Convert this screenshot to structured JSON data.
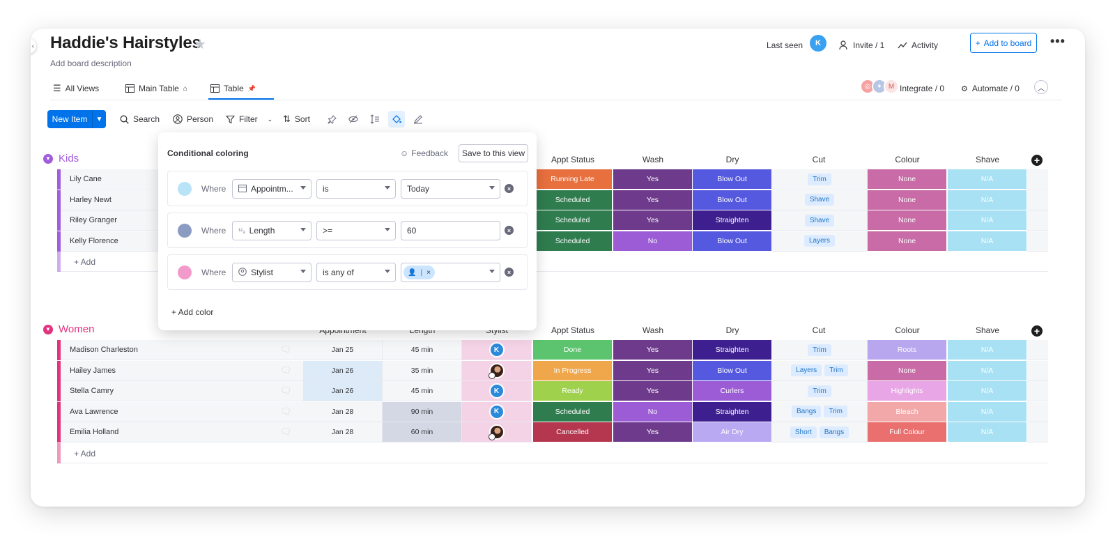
{
  "board": {
    "title": "Haddie's Hairstyles",
    "description": "Add board description"
  },
  "header": {
    "last_seen_label": "Last seen",
    "last_seen_avatar": "K",
    "invite_label": "Invite / 1",
    "activity_label": "Activity",
    "add_to_board_label": "Add to board"
  },
  "tabs": {
    "all_views": "All Views",
    "main_table": "Main Table",
    "table": "Table"
  },
  "integrations": {
    "integrate_label": "Integrate / 0",
    "automate_label": "Automate / 0"
  },
  "toolbar": {
    "new_item": "New Item",
    "search": "Search",
    "person": "Person",
    "filter": "Filter",
    "sort": "Sort"
  },
  "columns": {
    "appointment": "Appointment",
    "length": "Length",
    "stylist": "Stylist",
    "appt_status": "Appt Status",
    "wash": "Wash",
    "dry": "Dry",
    "cut": "Cut",
    "colour": "Colour",
    "shave": "Shave"
  },
  "groups": {
    "kids": {
      "title": "Kids",
      "color": "#a25ddc",
      "add_label": "+ Add",
      "rows": [
        {
          "name": "Lily Cane",
          "status": "Running Late",
          "status_color": "#e8703f",
          "wash": "Yes",
          "wash_color": "#6e3b8c",
          "dry": "Blow Out",
          "dry_color": "#5559df",
          "cut": [
            "Trim"
          ],
          "colour": "None",
          "colour_color": "#c86ba6",
          "shave": "N/A"
        },
        {
          "name": "Harley Newt",
          "status": "Scheduled",
          "status_color": "#2f7d4f",
          "wash": "Yes",
          "wash_color": "#6e3b8c",
          "dry": "Blow Out",
          "dry_color": "#5559df",
          "cut": [
            "Shave"
          ],
          "colour": "None",
          "colour_color": "#c86ba6",
          "shave": "N/A"
        },
        {
          "name": "Riley Granger",
          "status": "Scheduled",
          "status_color": "#2f7d4f",
          "wash": "Yes",
          "wash_color": "#6e3b8c",
          "dry": "Straighten",
          "dry_color": "#3d1f8f",
          "cut": [
            "Shave"
          ],
          "colour": "None",
          "colour_color": "#c86ba6",
          "shave": "N/A"
        },
        {
          "name": "Kelly Florence",
          "status": "Scheduled",
          "status_color": "#2f7d4f",
          "wash": "No",
          "wash_color": "#9c5cd6",
          "dry": "Blow Out",
          "dry_color": "#5559df",
          "cut": [
            "Layers"
          ],
          "colour": "None",
          "colour_color": "#c86ba6",
          "shave": "N/A"
        }
      ]
    },
    "women": {
      "title": "Women",
      "color": "#e2337f",
      "add_label": "+ Add",
      "rows": [
        {
          "name": "Madison Charleston",
          "appointment": "Jan 25",
          "length": "45 min",
          "stylist": "K",
          "status": "Done",
          "status_color": "#5cc46e",
          "wash": "Yes",
          "wash_color": "#6e3b8c",
          "dry": "Straighten",
          "dry_color": "#3d1f8f",
          "cut": [
            "Trim"
          ],
          "colour": "Roots",
          "colour_color": "#b8a6ee",
          "shave": "N/A"
        },
        {
          "name": "Hailey James",
          "appointment": "Jan 26",
          "length": "35 min",
          "stylist": "photo",
          "status": "In Progress",
          "status_color": "#f0a64a",
          "wash": "Yes",
          "wash_color": "#6e3b8c",
          "dry": "Blow Out",
          "dry_color": "#5559df",
          "cut": [
            "Layers",
            "Trim"
          ],
          "colour": "None",
          "colour_color": "#c86ba6",
          "shave": "N/A"
        },
        {
          "name": "Stella Camry",
          "appointment": "Jan 26",
          "length": "45 min",
          "stylist": "K",
          "status": "Ready",
          "status_color": "#9fd14c",
          "wash": "Yes",
          "wash_color": "#6e3b8c",
          "dry": "Curlers",
          "dry_color": "#9c5cd6",
          "cut": [
            "Trim"
          ],
          "colour": "Highlights",
          "colour_color": "#e9a6e6",
          "shave": "N/A"
        },
        {
          "name": "Ava Lawrence",
          "appointment": "Jan 28",
          "length": "90 min",
          "stylist": "K",
          "status": "Scheduled",
          "status_color": "#2f7d4f",
          "wash": "No",
          "wash_color": "#9c5cd6",
          "dry": "Straighten",
          "dry_color": "#3d1f8f",
          "cut": [
            "Bangs",
            "Trim"
          ],
          "colour": "Bleach",
          "colour_color": "#f2a8a8",
          "shave": "N/A"
        },
        {
          "name": "Emilia Holland",
          "appointment": "Jan 28",
          "length": "60 min",
          "stylist": "photo",
          "status": "Cancelled",
          "status_color": "#b5364f",
          "wash": "Yes",
          "wash_color": "#6e3b8c",
          "dry": "Air Dry",
          "dry_color": "#b9a8f2",
          "cut": [
            "Short",
            "Bangs"
          ],
          "colour": "Full Colour",
          "colour_color": "#ea6f6f",
          "shave": "N/A"
        }
      ]
    }
  },
  "shave_color": "#a8e1f4",
  "conditional_coloring": {
    "title": "Conditional coloring",
    "feedback": "Feedback",
    "save_view": "Save to this view",
    "where_label": "Where",
    "rules": [
      {
        "swatch": "#b9e4f7",
        "column": "Appointm...",
        "column_icon": "calendar-icon",
        "operator": "is",
        "value": "Today"
      },
      {
        "swatch": "#8c9bc2",
        "column": "Length",
        "column_icon": "numbers-icon",
        "operator": ">=",
        "value": "60"
      },
      {
        "swatch": "#f29bca",
        "column": "Stylist",
        "column_icon": "person-icon",
        "operator": "is any of",
        "value": ""
      }
    ],
    "add_color": "+ Add color"
  }
}
